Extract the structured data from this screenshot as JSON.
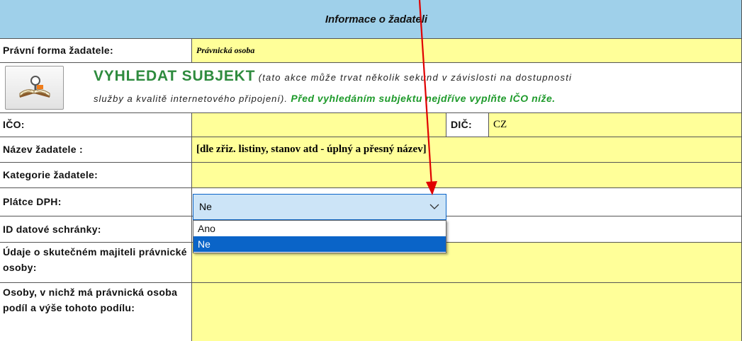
{
  "header": {
    "title": "Informace o žadateli"
  },
  "rows": {
    "pravni_forma": {
      "label": "Právní forma žadatele:",
      "value": "Právnická osoba"
    },
    "vyhledat": {
      "title": "VYHLEDAT SUBJEKT",
      "note_part1": "(tato akce může trvat několik sekund v závislosti na dostupnosti",
      "note_part2": "služby a kvalitě internetového připojení).",
      "note_green": "Před vyhledáním subjektu nejdříve vyplňte IČO níže."
    },
    "ico": {
      "label": "IČO:",
      "value": ""
    },
    "dic": {
      "label": "DIČ:",
      "value": "CZ"
    },
    "nazev": {
      "label": "Název žadatele :",
      "value": "[dle zřiz. listiny, stanov atd - úplný a přesný název]"
    },
    "kategorie": {
      "label": "Kategorie žadatele:"
    },
    "platce_dph": {
      "label": "Plátce DPH:",
      "selected": "Ne",
      "options": [
        "Ano",
        "Ne"
      ]
    },
    "datova_schranka": {
      "label": "ID datové schránky:"
    },
    "skutecny_majitel": {
      "label": "Údaje o skutečném majiteli právnické osoby:"
    },
    "osoby_podil": {
      "label": "Osoby, v nichž má právnická osoba podíl a výše tohoto podílu:"
    }
  },
  "colors": {
    "header": "#9fd0ea",
    "input_yellow": "#ffff99",
    "green_text": "#1e9a2b",
    "title_green": "#2e8b3e",
    "arrow_red": "#e00000",
    "select_blue": "#0a64c8"
  }
}
